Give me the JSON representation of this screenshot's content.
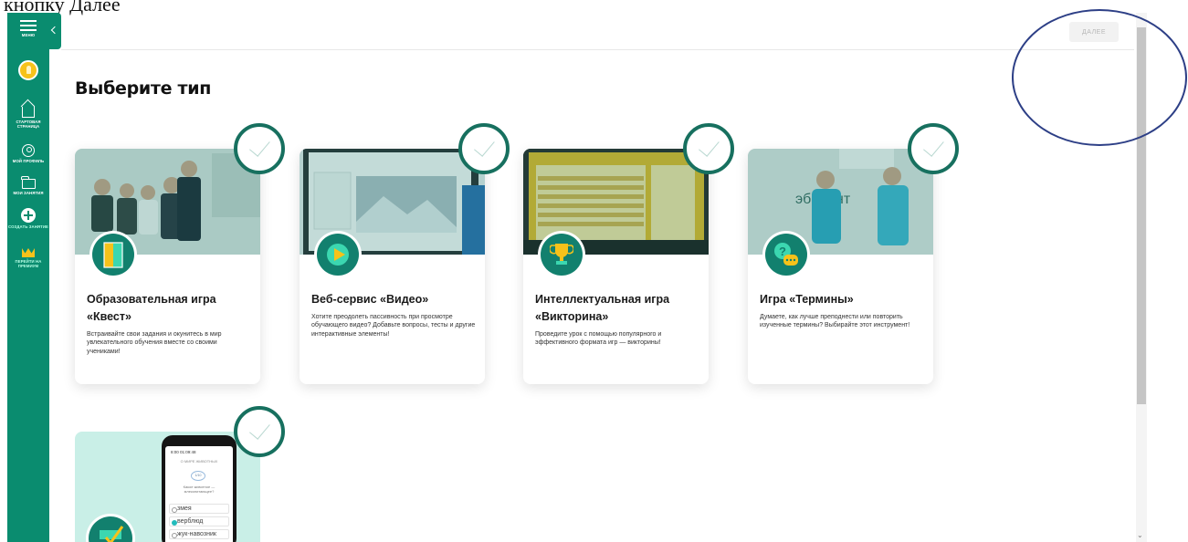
{
  "caption": "кнопку Далее",
  "sidebar": {
    "menu_label": "МЕНЮ",
    "items": [
      {
        "label": "СТАРТОВАЯ СТРАНИЦА"
      },
      {
        "label": "МОЙ ПРОФИЛЬ"
      },
      {
        "label": "МОИ ЗАНЯТИЯ"
      },
      {
        "label": "СОЗДАТЬ ЗАНЯТИЕ"
      },
      {
        "label": "ПЕРЕЙТИ НА ПРЕМИУМ"
      }
    ]
  },
  "header": {
    "next_label": "ДАЛЕЕ"
  },
  "main": {
    "title": "Выберите тип",
    "cards": [
      {
        "title": "Образовательная игра «Квест»",
        "description": "Встраивайте свои задания и окунитесь в мир увлекательного обучения вместе со своими учениками!"
      },
      {
        "title": "Веб-сервис «Видео»",
        "description": "Хотите преодолеть пассивность при просмотре обучающего видео? Добавьте вопросы, тесты и другие интерактивные элементы!"
      },
      {
        "title": "Интеллектуальная игра «Викторина»",
        "description": "Проведите урок с помощью популярного и эффективного формата игр — викторины!"
      },
      {
        "title": "Игра «Термины»",
        "description": "Думаете, как лучше преподнести или повторить изученные термины? Выбирайте этот инструмент!"
      }
    ],
    "bottom_card": {
      "phone_time": "8:00   01:09:48",
      "phone_header": "О МИРЕ ЖИВОТНЫХ",
      "phone_counter": "1/10",
      "phone_question": "Какое животное — млекопитающее?",
      "options": [
        "змея",
        "верблюд",
        "жук-навозник"
      ]
    }
  },
  "colors": {
    "sidebar": "#0a8c6f",
    "accent_ring": "#17705f",
    "highlight": "#2d3f86"
  }
}
